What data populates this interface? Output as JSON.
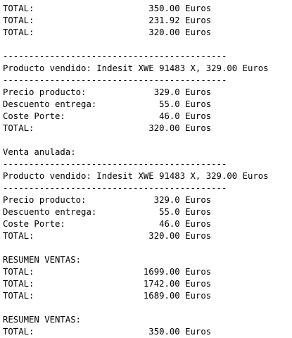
{
  "console": {
    "lines": [
      "TOTAL:                      350.00 Euros",
      "TOTAL:                      231.92 Euros",
      "TOTAL:                      320.00 Euros",
      "",
      "-------------------------------------------",
      "Producto vendido: Indesit XWE 91483 X, 329.00 Euros",
      "-------------------------------------------",
      "Precio producto:             329.0 Euros",
      "Descuento entrega:            55.0 Euros",
      "Coste Porte:                  46.0 Euros",
      "TOTAL:                      320.00 Euros",
      "",
      "Venta anulada:",
      "-------------------------------------------",
      "Producto vendido: Indesit XWE 91483 X, 329.00 Euros",
      "-------------------------------------------",
      "Precio producto:             329.0 Euros",
      "Descuento entrega:            55.0 Euros",
      "Coste Porte:                  46.0 Euros",
      "TOTAL:                      320.00 Euros",
      "",
      "RESUMEN VENTAS:",
      "TOTAL:                     1699.00 Euros",
      "TOTAL:                     1742.00 Euros",
      "TOTAL:                     1689.00 Euros",
      "",
      "RESUMEN VENTAS:",
      "TOTAL:                      350.00 Euros"
    ]
  }
}
